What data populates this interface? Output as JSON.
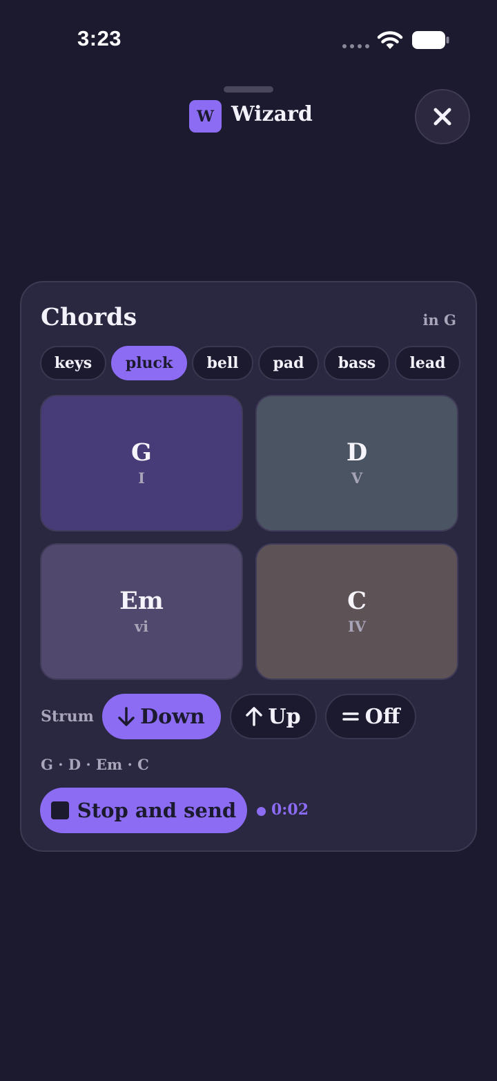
{
  "status_bar": {
    "time": "3:23"
  },
  "header": {
    "app_icon_letter": "W",
    "title": "Wizard"
  },
  "card": {
    "title": "Chords",
    "key": "in G",
    "instruments": [
      {
        "label": "keys",
        "active": false
      },
      {
        "label": "pluck",
        "active": true
      },
      {
        "label": "bell",
        "active": false
      },
      {
        "label": "pad",
        "active": false
      },
      {
        "label": "bass",
        "active": false
      },
      {
        "label": "lead",
        "active": false
      }
    ],
    "pads": [
      {
        "name": "G",
        "numeral": "I",
        "color": "#473b78"
      },
      {
        "name": "D",
        "numeral": "V",
        "color": "#4b5462"
      },
      {
        "name": "Em",
        "numeral": "vi",
        "color": "#51486d"
      },
      {
        "name": "C",
        "numeral": "IV",
        "color": "#5d5357"
      }
    ],
    "strum": {
      "label": "Strum",
      "options": [
        {
          "label": "Down",
          "icon": "arrow-down-icon",
          "active": true
        },
        {
          "label": "Up",
          "icon": "arrow-up-icon",
          "active": false
        },
        {
          "label": "Off",
          "icon": "equals-icon",
          "active": false
        }
      ]
    },
    "progression": "G · D · Em · C",
    "recording": {
      "button_label": "Stop and send",
      "elapsed": "0:02"
    }
  },
  "colors": {
    "background": "#1c1a2e",
    "card": "#2a2740",
    "accent": "#8b6cf2",
    "text": "#f3f1fa",
    "muted": "#a9a5ba"
  }
}
